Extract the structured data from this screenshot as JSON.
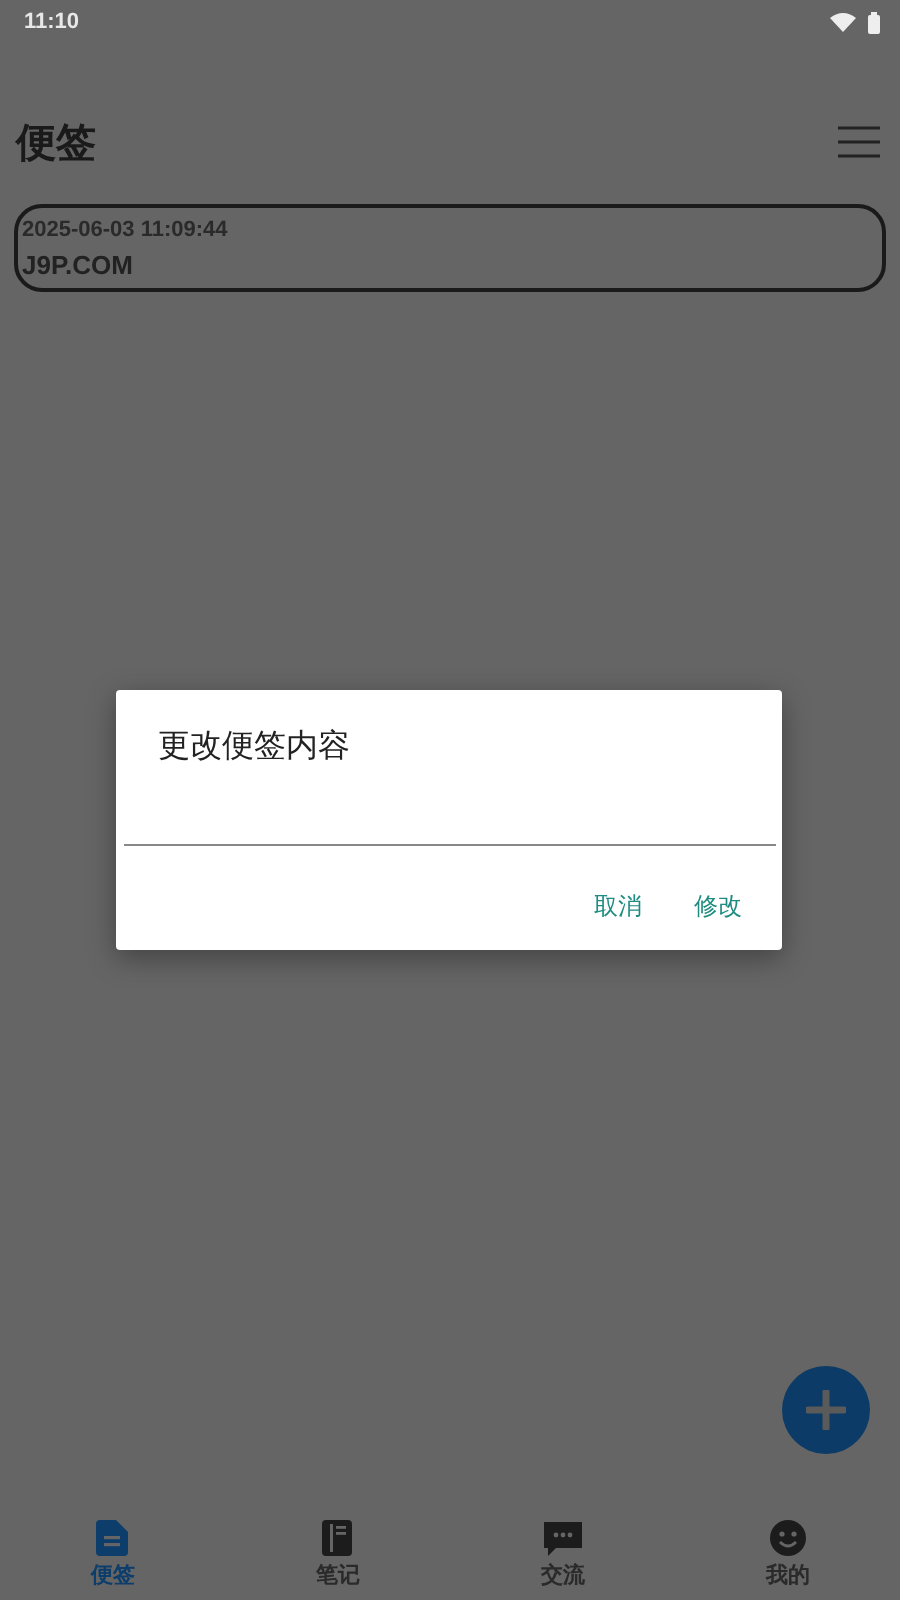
{
  "status_bar": {
    "time": "11:10"
  },
  "header": {
    "title": "便签"
  },
  "notes": [
    {
      "time": "2025-06-03 11:09:44",
      "content": "J9P.COM"
    }
  ],
  "dialog": {
    "title": "更改便签内容",
    "buttons": [
      "取消",
      "修改"
    ]
  },
  "bottom_nav": [
    {
      "label": "便签",
      "selected": true
    },
    {
      "label": "笔记",
      "selected": false
    },
    {
      "label": "交流",
      "selected": false
    },
    {
      "label": "我的",
      "selected": false
    }
  ]
}
